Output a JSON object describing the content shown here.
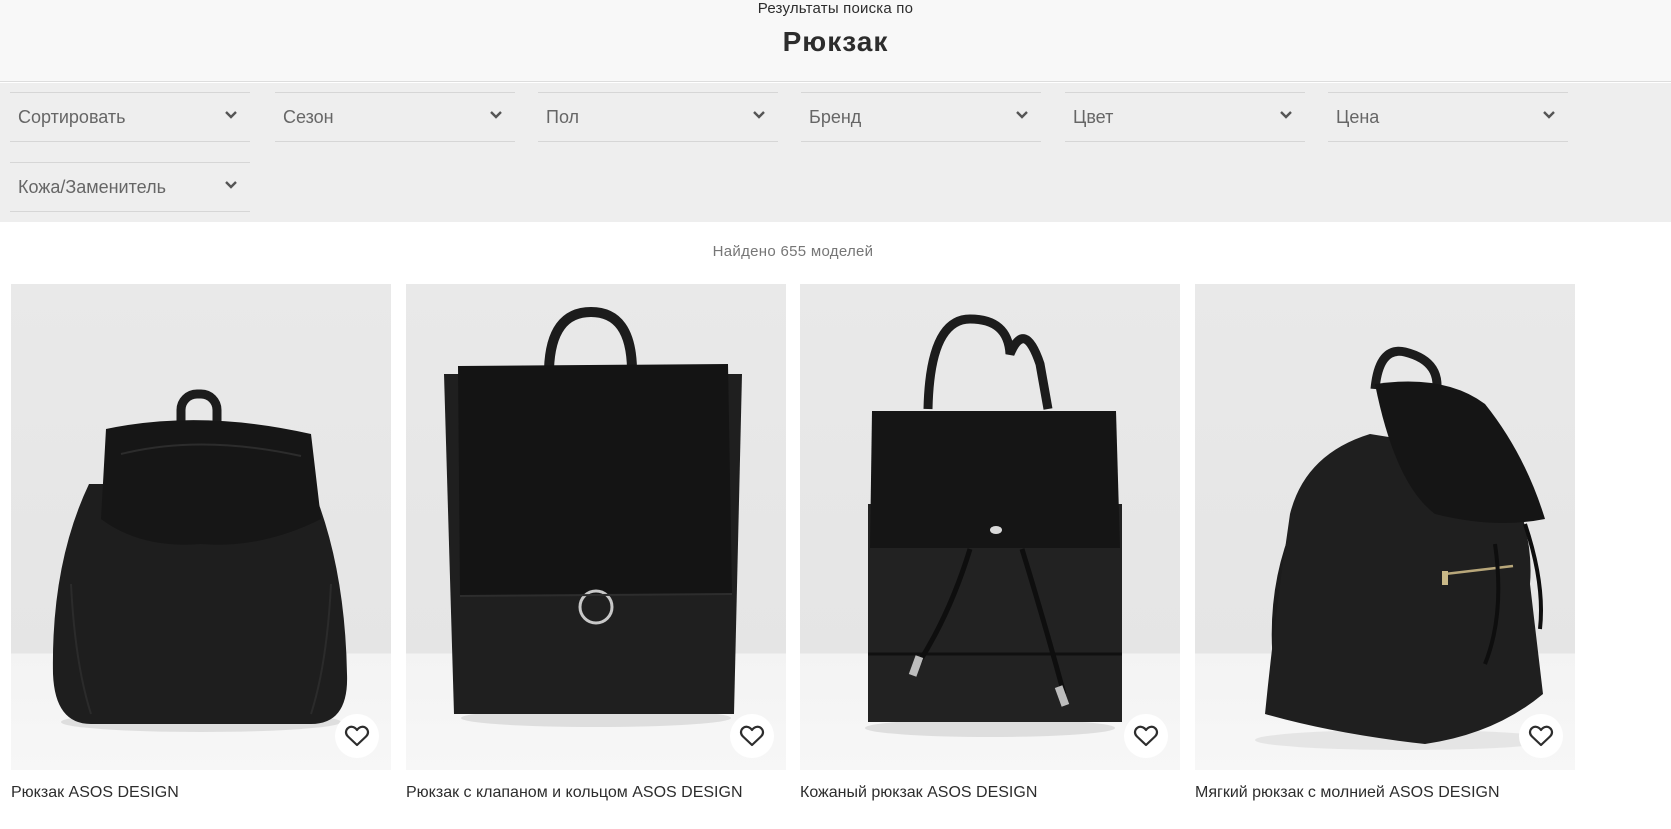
{
  "header": {
    "caption": "Результаты поиска по",
    "search_term": "Рюкзак"
  },
  "filters": [
    {
      "label": "Сортировать"
    },
    {
      "label": "Сезон"
    },
    {
      "label": "Пол"
    },
    {
      "label": "Бренд"
    },
    {
      "label": "Цвет"
    },
    {
      "label": "Цена"
    },
    {
      "label": "Кожа/Заменитель"
    }
  ],
  "filter_icon": "chevron-down-icon",
  "results": {
    "count_text": "Найдено 655 моделей"
  },
  "products": [
    {
      "title": "Рюкзак ASOS DESIGN",
      "image": "black-drawstring-backpack",
      "save_icon": "heart-icon"
    },
    {
      "title": "Рюкзак с клапаном и кольцом ASOS DESIGN",
      "image": "black-flap-ring-backpack",
      "save_icon": "heart-icon"
    },
    {
      "title": "Кожаный рюкзак ASOS DESIGN",
      "image": "black-leather-backpack",
      "save_icon": "heart-icon"
    },
    {
      "title": "Мягкий рюкзак с молнией ASOS DESIGN",
      "image": "black-soft-zip-backpack",
      "save_icon": "heart-icon"
    }
  ],
  "colors": {
    "header_bg": "#f8f8f8",
    "filters_bg": "#eeeeee",
    "text": "#2d2d2d",
    "muted_text": "#767676",
    "product_black": "#1c1c1c"
  }
}
